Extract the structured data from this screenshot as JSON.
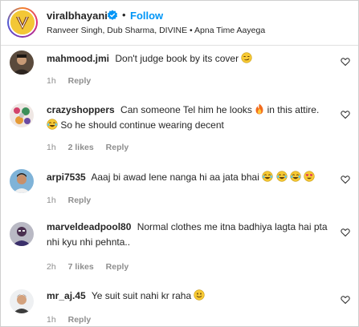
{
  "post": {
    "username": "viralbhayani",
    "follow_label": "Follow",
    "dot": "•",
    "subtitle": "Ranveer Singh, Dub Sharma, DIVINE • Apna Time Aayega"
  },
  "comments": [
    {
      "user": "mahmood.jmi",
      "text": "Don't judge book by its cover",
      "time": "1h",
      "likes": "",
      "reply": "Reply"
    },
    {
      "user": "crazyshoppers",
      "text1": "Can someone Tel him he looks",
      "text2": "in this attire.",
      "text3": "So he should continue wearing decent",
      "time": "1h",
      "likes": "2 likes",
      "reply": "Reply"
    },
    {
      "user": "arpi7535",
      "text": "Aaaj bi awad lene nanga hi aa jata bhai",
      "time": "1h",
      "likes": "",
      "reply": "Reply"
    },
    {
      "user": "marveldeadpool80",
      "text": "Normal clothes me itna badhiya lagta hai pta nhi kyu nhi pehnta..",
      "time": "2h",
      "likes": "7 likes",
      "reply": "Reply"
    },
    {
      "user": "mr_aj.45",
      "text": "Ye suit suit nahi kr raha",
      "time": "1h",
      "likes": "",
      "reply": "Reply"
    }
  ],
  "colors": {
    "accent": "#0095f6",
    "text": "#262626",
    "muted": "#8e8e8e"
  }
}
